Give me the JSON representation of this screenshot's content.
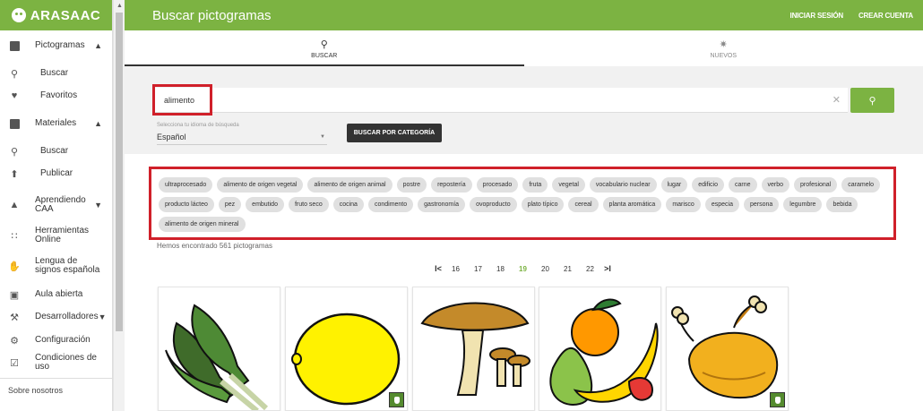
{
  "brand": {
    "name": "ARASAAC",
    "accent": "#7cb342"
  },
  "sidebar": {
    "items": [
      {
        "label": "Pictogramas",
        "icon": "image-icon",
        "chevron": "^"
      },
      {
        "label": "Buscar",
        "icon": "search-icon",
        "sub": true
      },
      {
        "label": "Favoritos",
        "icon": "heart-icon",
        "sub": true
      },
      {
        "label": "Materiales",
        "icon": "book-icon",
        "chevron": "^"
      },
      {
        "label": "Buscar",
        "icon": "search-icon",
        "sub": true
      },
      {
        "label": "Publicar",
        "icon": "upload-icon",
        "sub": true
      },
      {
        "label": "Aprendiendo CAA",
        "icon": "school-icon",
        "chevron": "v"
      },
      {
        "label": "Herramientas Online",
        "icon": "apps-icon"
      },
      {
        "label": "Lengua de signos española",
        "icon": "sign-language-icon"
      },
      {
        "label": "Aula abierta",
        "icon": "classroom-icon"
      },
      {
        "label": "Desarrolladores",
        "icon": "wrench-icon",
        "chevron": "v"
      },
      {
        "label": "Configuración",
        "icon": "gear-icon"
      },
      {
        "label": "Condiciones de uso",
        "icon": "checkbox-icon"
      }
    ],
    "about": "Sobre nosotros"
  },
  "header": {
    "title": "Buscar pictogramas",
    "login": "INICIAR SESIÓN",
    "signup": "CREAR CUENTA"
  },
  "tabs": [
    {
      "label": "BUSCAR",
      "active": true
    },
    {
      "label": "NUEVOS",
      "active": false
    }
  ],
  "search": {
    "value": "alimento",
    "lang_label": "Selecciona tu idioma de búsqueda",
    "lang_value": "Español",
    "category_button": "BUSCAR POR CATEGORÍA"
  },
  "tags": [
    "ultraprocesado",
    "alimento de origen vegetal",
    "alimento de origen animal",
    "postre",
    "repostería",
    "procesado",
    "fruta",
    "vegetal",
    "vocabulario nuclear",
    "lugar",
    "edificio",
    "carne",
    "verbo",
    "profesional",
    "caramelo",
    "producto lácteo",
    "pez",
    "embutido",
    "fruto seco",
    "cocina",
    "condimento",
    "gastronomía",
    "ovoproducto",
    "plato típico",
    "cereal",
    "planta aromática",
    "marisco",
    "especia",
    "persona",
    "legumbre",
    "bebida",
    "alimento de origen mineral"
  ],
  "results": {
    "count_text": "Hemos encontrado 561 pictogramas",
    "first_label": "I<",
    "pages": [
      "16",
      "17",
      "18",
      "19",
      "20",
      "21",
      "22"
    ],
    "current_page": "19",
    "last_label": ">I"
  },
  "pictograms": [
    {
      "subject": "chard",
      "touch": false
    },
    {
      "subject": "lemon",
      "touch": true
    },
    {
      "subject": "mushroom",
      "touch": false
    },
    {
      "subject": "fruit",
      "touch": false
    },
    {
      "subject": "roast-chicken",
      "touch": true
    }
  ]
}
